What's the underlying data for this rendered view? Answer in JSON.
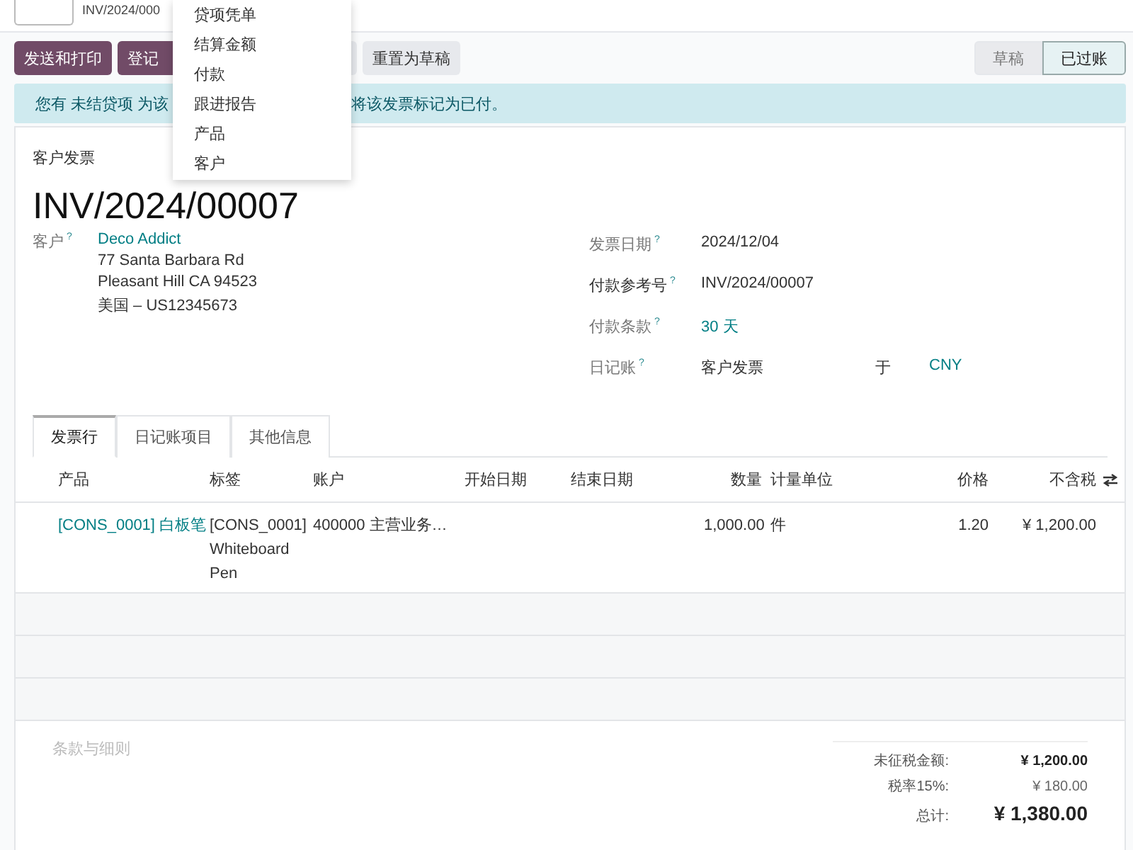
{
  "breadcrumb": {
    "record": "INV/2024/000"
  },
  "toolbar": {
    "buttons": [
      {
        "label": "发送和打印",
        "kind": "primary"
      },
      {
        "label": "登记",
        "kind": "primary"
      },
      {
        "kind": "hidden"
      },
      {
        "label": "重置为草稿",
        "kind": "secondary"
      }
    ]
  },
  "status_stages": [
    {
      "label": "草稿",
      "selected": false
    },
    {
      "label": "已过账",
      "selected": true
    }
  ],
  "alert": {
    "parts": [
      "您有 未结贷项 为该",
      "将该发票标记为已付。"
    ]
  },
  "dropdown": {
    "items": [
      "贷项凭单",
      "结算金额",
      "付款",
      "跟进报告",
      "产品",
      "客户"
    ]
  },
  "document": {
    "type": "客户发票",
    "number": "INV/2024/00007"
  },
  "customer": {
    "label": "客户",
    "help": "?",
    "name": "Deco Addict",
    "address": [
      "77 Santa Barbara Rd",
      "Pleasant Hill CA 94523",
      "美国 – US12345673"
    ]
  },
  "info_fields": [
    {
      "label": "发票日期",
      "help": "?",
      "value": "2024/12/04",
      "kind": "plain"
    },
    {
      "label": "付款参考号",
      "help": "?",
      "value": "INV/2024/00007",
      "kind": "plain"
    },
    {
      "label": "付款条款",
      "help": "?",
      "value": "30 天",
      "kind": "link"
    },
    {
      "label": "日记账",
      "help": "?",
      "value": "客户发票",
      "kind": "currency",
      "connector": "于",
      "currency": "CNY"
    }
  ],
  "tabs": [
    {
      "label": "发票行",
      "selected": true
    },
    {
      "label": "日记账项目",
      "selected": false
    },
    {
      "label": "其他信息",
      "selected": false
    }
  ],
  "table": {
    "columns": [
      "产品",
      "标签",
      "账户",
      "开始日期",
      "结束日期",
      "数量",
      "计量单位",
      "价格",
      "不含税"
    ],
    "rows": [
      {
        "cells": [
          "[CONS_0001] 白板笔",
          "[CONS_0001] Whiteboard Pen",
          "400000 主营业务…",
          "",
          "",
          "1,000.00",
          "件",
          "1.20",
          "¥ 1,200.00"
        ]
      }
    ]
  },
  "terms_placeholder": "条款与细则",
  "totals": [
    {
      "label": "未征税金额:",
      "value": "¥ 1,200.00",
      "kind": "subtotal"
    },
    {
      "label": "税率15%:",
      "value": "¥ 180.00",
      "kind": "tax"
    },
    {
      "label": "总计:",
      "value": "¥ 1,380.00",
      "kind": "total"
    }
  ]
}
